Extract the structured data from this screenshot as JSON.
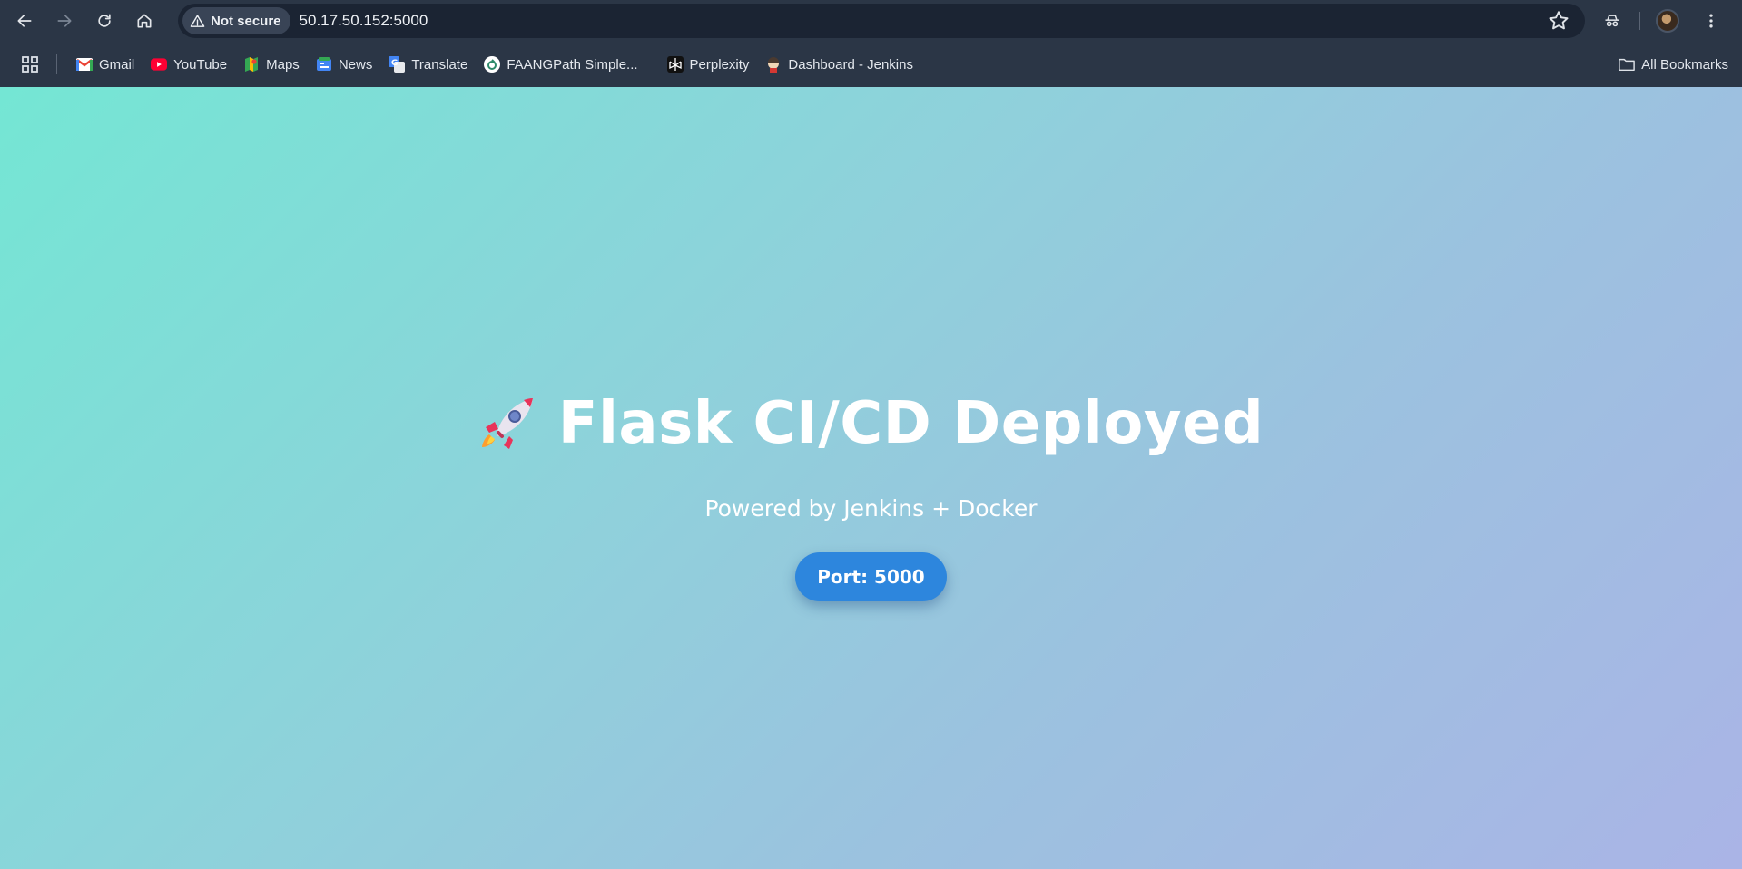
{
  "browser": {
    "security_label": "Not secure",
    "url": "50.17.50.152:5000",
    "bookmarks": [
      {
        "label": "Gmail",
        "icon": "gmail-icon"
      },
      {
        "label": "YouTube",
        "icon": "youtube-icon"
      },
      {
        "label": "Maps",
        "icon": "maps-icon"
      },
      {
        "label": "News",
        "icon": "news-icon"
      },
      {
        "label": "Translate",
        "icon": "translate-icon"
      },
      {
        "label": "FAANGPath Simple...",
        "icon": "faangpath-icon"
      },
      {
        "label": "Perplexity",
        "icon": "perplexity-icon"
      },
      {
        "label": "Dashboard - Jenkins",
        "icon": "jenkins-icon"
      }
    ],
    "all_bookmarks_label": "All Bookmarks"
  },
  "page": {
    "title": "Flask CI/CD Deployed",
    "subtitle": "Powered by Jenkins + Docker",
    "port_label": "Port: 5000",
    "colors": {
      "gradient_start": "#74e6d4",
      "gradient_end": "#aab4e6",
      "button": "#2d86dd"
    }
  }
}
